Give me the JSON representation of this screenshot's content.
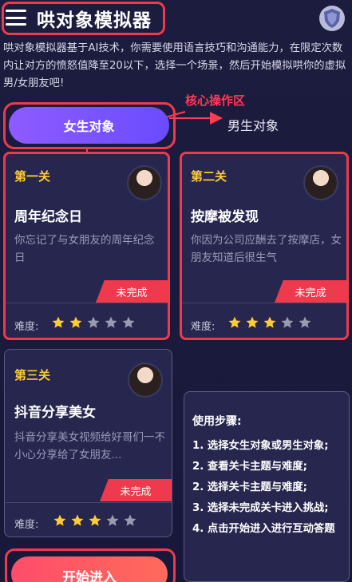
{
  "header": {
    "title": "哄对象模拟器"
  },
  "intro": "哄对象模拟器基于AI技术，你需要使用语言技巧和沟通能力，在限定次数内让对方的愤怒值降至20以下，选择一个场景，然后开始模拟哄你的虚拟男/女朋友吧!",
  "annotation": "核心操作区",
  "toggle": {
    "female": "女生对象",
    "male": "男生对象"
  },
  "levels": [
    {
      "no": "第一关",
      "title": "周年纪念日",
      "desc": "你忘记了与女朋友的周年纪念日",
      "status": "未完成",
      "difficulty_label": "难度:",
      "difficulty": 2,
      "max": 5
    },
    {
      "no": "第二关",
      "title": "按摩被发现",
      "desc": "你因为公司应酬去了按摩店，女朋友知道后很生气",
      "status": "未完成",
      "difficulty_label": "难度:",
      "difficulty": 3,
      "max": 5
    },
    {
      "no": "第三关",
      "title": "抖音分享美女",
      "desc": "抖音分享美女视频给好哥们一不小心分享给了女朋友...",
      "status": "未完成",
      "difficulty_label": "难度:",
      "difficulty": 3,
      "max": 5
    }
  ],
  "steps": {
    "title": "使用步骤:",
    "items": [
      "1. 选择女生对象或男生对象;",
      "2. 查看关卡主题与难度;",
      "2. 选择关卡主题与难度;",
      "3. 选择未完成关卡进入挑战;",
      "4. 点击开始进入进行互动答题"
    ]
  },
  "start_button": "开始进入",
  "colors": {
    "accent_red": "#ee3a4c",
    "star_gold": "#ffcc33",
    "purple": "#7a55ff"
  }
}
